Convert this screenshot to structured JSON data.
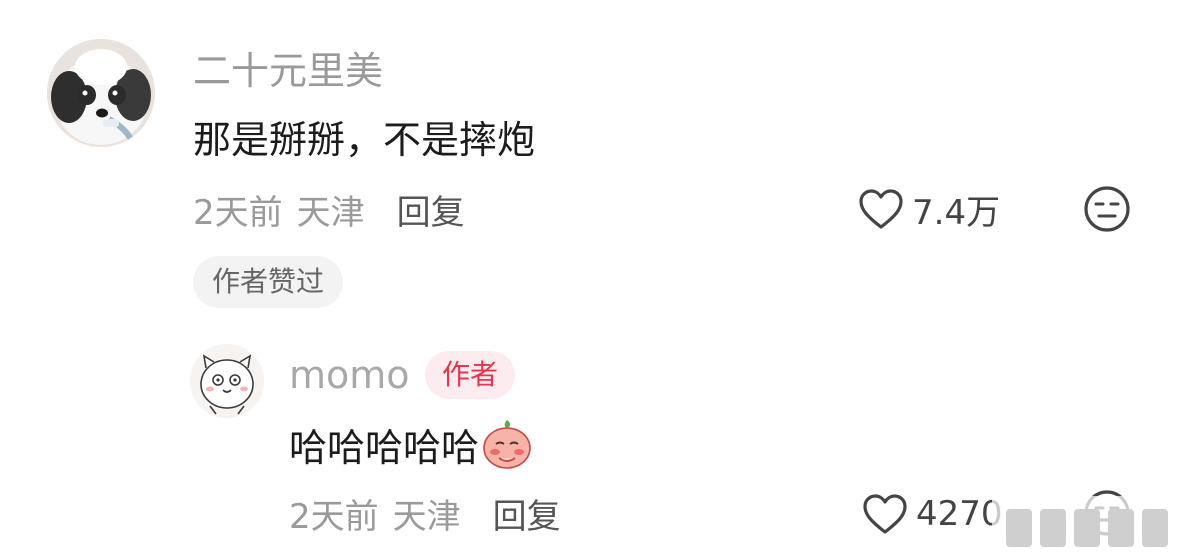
{
  "main_comment": {
    "username": "二十元里美",
    "text": "那是掰掰，不是摔炮",
    "time": "2天前",
    "location": "天津",
    "reply_label": "回复",
    "like_count": "7.4万",
    "author_liked_tag": "作者赞过",
    "avatar_icon": "dog-avatar-icon",
    "like_icon": "heart-outline-icon",
    "dislike_icon": "meh-face-icon"
  },
  "reply": {
    "username": "momo",
    "author_badge": "作者",
    "text": "哈哈哈哈哈",
    "emoji_icon": "peach-emoji-icon",
    "time": "2天前",
    "location": "天津",
    "reply_label": "回复",
    "like_count": "4270",
    "avatar_icon": "cartoon-cat-avatar-icon",
    "like_icon": "heart-outline-icon",
    "dislike_icon": "meh-face-icon"
  },
  "colors": {
    "username_gray": "#9a9a9a",
    "body_text": "#1c1c1c",
    "author_badge_text": "#e8334f",
    "author_badge_bg": "#fdecef",
    "tag_bg": "#f3f3f3"
  }
}
